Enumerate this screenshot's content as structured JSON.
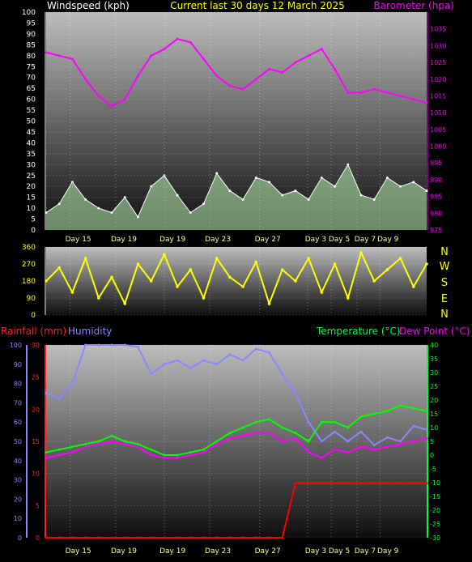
{
  "header": {
    "left_title": "Windspeed (kph)",
    "center_title": "Current last 30 days 12 March 2025",
    "right_title": "Barometer (hpa)"
  },
  "colors": {
    "wind": "#ffffff",
    "wind_fill": "#b8f0b0",
    "gust": "#d8f0d8",
    "barometer": "#ff00ff",
    "direction": "#ffff00",
    "rain": "#ff0000",
    "humidity": "#8888ff",
    "temperature": "#00ff00",
    "dewpoint": "#ff00ff",
    "title_yellow": "#ffff00"
  },
  "x_days": [
    "Day 15",
    "Day 19",
    "Day 19",
    "Day 23",
    "Day 27",
    "Day 3",
    "Day 5",
    "Day 7",
    "Day 9"
  ],
  "compass": [
    "N",
    "W",
    "S",
    "E",
    "N"
  ],
  "bottom_legend": {
    "rainfall": "Rainfall (mm)",
    "humidity": "Humidity",
    "temperature": "Temperature (°C)",
    "dewpoint": "Dew Point (°C)"
  },
  "chart_data": [
    {
      "type": "line",
      "title": "Current last 30 days 12 March 2025",
      "ylabel": "Windspeed (kph)",
      "y2label": "Barometer (hpa)",
      "ylim": [
        0,
        100
      ],
      "y2lim": [
        975,
        1040
      ],
      "yticks": [
        0,
        5,
        10,
        15,
        20,
        25,
        30,
        35,
        40,
        45,
        50,
        55,
        60,
        65,
        70,
        75,
        80,
        85,
        90,
        95,
        100
      ],
      "y2ticks": [
        975,
        980,
        985,
        990,
        995,
        1000,
        1005,
        1010,
        1015,
        1020,
        1025,
        1030,
        1035
      ],
      "series": [
        {
          "name": "Windspeed (kph)",
          "x": [
            0,
            1,
            2,
            3,
            4,
            5,
            6,
            7,
            8,
            9,
            10,
            11,
            12,
            13,
            14,
            15,
            16,
            17,
            18,
            19,
            20,
            21,
            22,
            23,
            24,
            25,
            26,
            27,
            28,
            29
          ],
          "values": [
            8,
            12,
            22,
            14,
            10,
            8,
            15,
            6,
            20,
            25,
            16,
            8,
            12,
            26,
            18,
            14,
            24,
            22,
            16,
            18,
            14,
            24,
            20,
            30,
            16,
            14,
            24,
            20,
            22,
            18
          ]
        },
        {
          "name": "Barometer (hpa)",
          "x": [
            0,
            1,
            2,
            3,
            4,
            5,
            6,
            7,
            8,
            9,
            10,
            11,
            12,
            13,
            14,
            15,
            16,
            17,
            18,
            19,
            20,
            21,
            22,
            23,
            24,
            25,
            26,
            27,
            28,
            29
          ],
          "values": [
            1028,
            1027,
            1026,
            1020,
            1015,
            1012,
            1014,
            1021,
            1027,
            1029,
            1032,
            1031,
            1026,
            1021,
            1018,
            1017,
            1020,
            1023,
            1022,
            1025,
            1027,
            1029,
            1023,
            1016,
            1016,
            1017,
            1016,
            1015,
            1014,
            1013
          ]
        }
      ]
    },
    {
      "type": "line",
      "ylabel": "Wind direction",
      "ylim": [
        0,
        360
      ],
      "yticks": [
        0,
        90,
        180,
        270,
        360
      ],
      "series": [
        {
          "name": "Wind direction",
          "x": [
            0,
            1,
            2,
            3,
            4,
            5,
            6,
            7,
            8,
            9,
            10,
            11,
            12,
            13,
            14,
            15,
            16,
            17,
            18,
            19,
            20,
            21,
            22,
            23,
            24,
            25,
            26,
            27,
            28,
            29
          ],
          "values": [
            180,
            250,
            120,
            300,
            90,
            200,
            60,
            270,
            180,
            320,
            150,
            240,
            90,
            300,
            200,
            150,
            280,
            60,
            240,
            180,
            300,
            120,
            270,
            90,
            330,
            180,
            240,
            300,
            150,
            270
          ]
        }
      ]
    },
    {
      "type": "line",
      "ylabel": "Rainfall (mm)",
      "ylim": [
        0,
        30
      ],
      "yticks": [
        0,
        5,
        10,
        15,
        20,
        25,
        30
      ],
      "y_hum_lim": [
        0,
        100
      ],
      "y_hum_ticks": [
        0,
        10,
        20,
        30,
        40,
        50,
        60,
        70,
        80,
        90,
        100
      ],
      "y2label": "Temperature (°C)",
      "y2lim": [
        -30,
        40
      ],
      "y2ticks": [
        -30,
        -25,
        -20,
        -15,
        -10,
        -5,
        0,
        5,
        10,
        15,
        20,
        25,
        30,
        35,
        40
      ],
      "series": [
        {
          "name": "Humidity",
          "x": [
            0,
            1,
            2,
            3,
            4,
            5,
            6,
            7,
            8,
            9,
            10,
            11,
            12,
            13,
            14,
            15,
            16,
            17,
            18,
            19,
            20,
            21,
            22,
            23,
            24,
            25,
            26,
            27,
            28,
            29
          ],
          "values": [
            75,
            72,
            80,
            100,
            100,
            100,
            100,
            99,
            85,
            90,
            92,
            88,
            92,
            90,
            95,
            92,
            98,
            96,
            85,
            75,
            60,
            50,
            55,
            50,
            55,
            48,
            52,
            50,
            58,
            56
          ]
        },
        {
          "name": "Temperature (°C)",
          "x": [
            0,
            1,
            2,
            3,
            4,
            5,
            6,
            7,
            8,
            9,
            10,
            11,
            12,
            13,
            14,
            15,
            16,
            17,
            18,
            19,
            20,
            21,
            22,
            23,
            24,
            25,
            26,
            27,
            28,
            29
          ],
          "values": [
            1,
            2,
            3,
            4,
            5,
            7,
            5,
            4,
            2,
            0,
            0,
            1,
            2,
            5,
            8,
            10,
            12,
            13,
            10,
            8,
            5,
            12,
            12,
            10,
            14,
            15,
            16,
            18,
            17,
            16
          ]
        },
        {
          "name": "Dew Point (°C)",
          "x": [
            0,
            1,
            2,
            3,
            4,
            5,
            6,
            7,
            8,
            9,
            10,
            11,
            12,
            13,
            14,
            15,
            16,
            17,
            18,
            19,
            20,
            21,
            22,
            23,
            24,
            25,
            26,
            27,
            28,
            29
          ],
          "values": [
            -1,
            0,
            1,
            3,
            4,
            5,
            4,
            3,
            0,
            -1,
            -1,
            0,
            1,
            4,
            6,
            7,
            8,
            8,
            5,
            6,
            1,
            -1,
            2,
            1,
            3,
            2,
            3,
            4,
            5,
            6
          ]
        },
        {
          "name": "Rainfall (mm)",
          "x": [
            0,
            1,
            2,
            3,
            4,
            5,
            6,
            7,
            8,
            9,
            10,
            11,
            12,
            13,
            14,
            15,
            16,
            17,
            18,
            19,
            20,
            21,
            22,
            23,
            24,
            25,
            26,
            27,
            28,
            29
          ],
          "values": [
            0,
            0,
            0,
            0,
            0,
            0,
            0,
            0,
            0,
            0,
            0,
            0,
            0,
            0,
            0,
            0,
            0,
            0,
            0,
            8.5,
            8.5,
            8.5,
            8.5,
            8.5,
            8.5,
            8.5,
            8.5,
            8.5,
            8.5,
            8.5
          ]
        }
      ]
    }
  ]
}
